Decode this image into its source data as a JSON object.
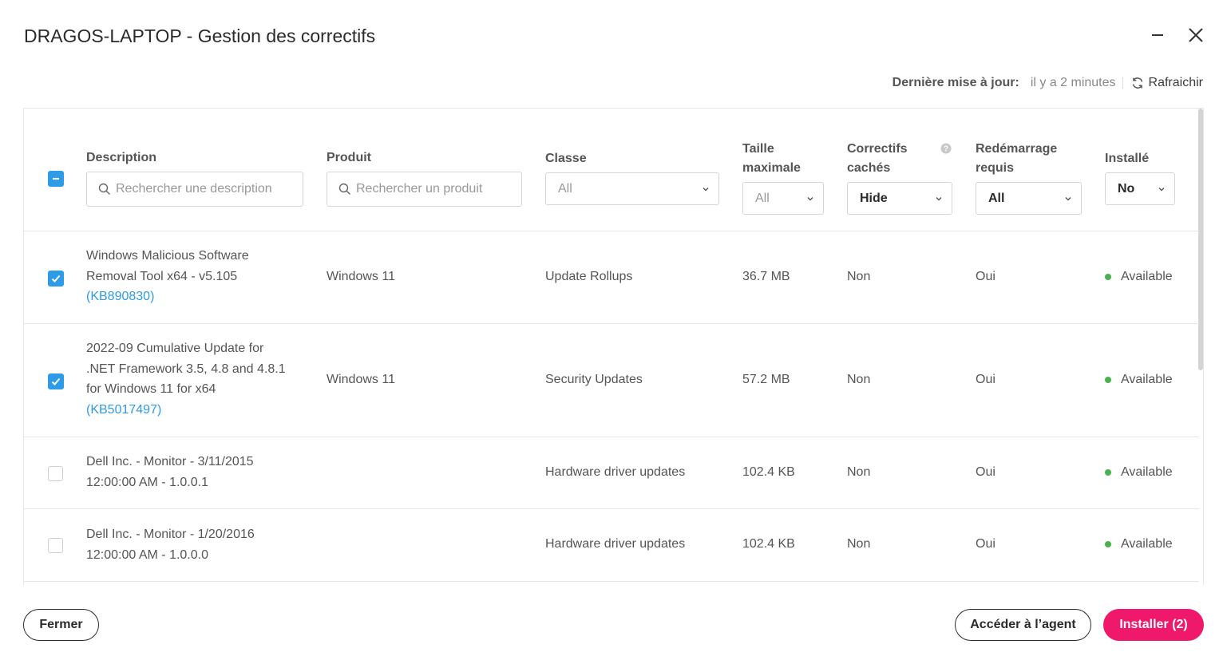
{
  "dialog": {
    "title": "DRAGOS-LAPTOP - Gestion des correctifs"
  },
  "refresh": {
    "label": "Dernière mise à jour:",
    "value": "il y a 2 minutes",
    "button": "Rafraichir"
  },
  "columns": {
    "description": {
      "label": "Description",
      "placeholder": "Rechercher une description"
    },
    "product": {
      "label": "Produit",
      "placeholder": "Rechercher un produit"
    },
    "class": {
      "label": "Classe",
      "selected": "All"
    },
    "size": {
      "label_line1": "Taille",
      "label_line2": "maximale",
      "selected": "All"
    },
    "hidden": {
      "label_line1": "Correctifs",
      "label_line2": "cachés",
      "selected": "Hide"
    },
    "reboot": {
      "label_line1": "Redémarrage",
      "label_line2": "requis",
      "selected": "All"
    },
    "installed": {
      "label": "Installé",
      "selected": "No"
    }
  },
  "header_checkbox": "indeterminate",
  "rows": [
    {
      "checked": true,
      "desc_lines": [
        "Windows Malicious Software",
        "Removal Tool x64 - v5.105"
      ],
      "kb": "(KB890830)",
      "product": "Windows 11",
      "class": "Update Rollups",
      "size": "36.7 MB",
      "hidden": "Non",
      "reboot": "Oui",
      "status": "Available"
    },
    {
      "checked": true,
      "desc_lines": [
        "2022-09 Cumulative Update for",
        ".NET Framework 3.5, 4.8 and 4.8.1",
        "for Windows 11 for x64"
      ],
      "kb": "(KB5017497)",
      "product": "Windows 11",
      "class": "Security Updates",
      "size": "57.2 MB",
      "hidden": "Non",
      "reboot": "Oui",
      "status": "Available"
    },
    {
      "checked": false,
      "desc_lines": [
        "Dell Inc. - Monitor - 3/11/2015",
        "12:00:00 AM - 1.0.0.1"
      ],
      "kb": "",
      "product": "",
      "class": "Hardware driver updates",
      "size": "102.4 KB",
      "hidden": "Non",
      "reboot": "Oui",
      "status": "Available"
    },
    {
      "checked": false,
      "desc_lines": [
        "Dell Inc. - Monitor - 1/20/2016",
        "12:00:00 AM - 1.0.0.0"
      ],
      "kb": "",
      "product": "",
      "class": "Hardware driver updates",
      "size": "102.4 KB",
      "hidden": "Non",
      "reboot": "Oui",
      "status": "Available"
    }
  ],
  "footer": {
    "close": "Fermer",
    "agent": "Accéder à l’agent",
    "install": "Installer (2)"
  },
  "colors": {
    "accent": "#2d9be8",
    "primary_button": "#f0186b",
    "status_available": "#4caf50"
  }
}
